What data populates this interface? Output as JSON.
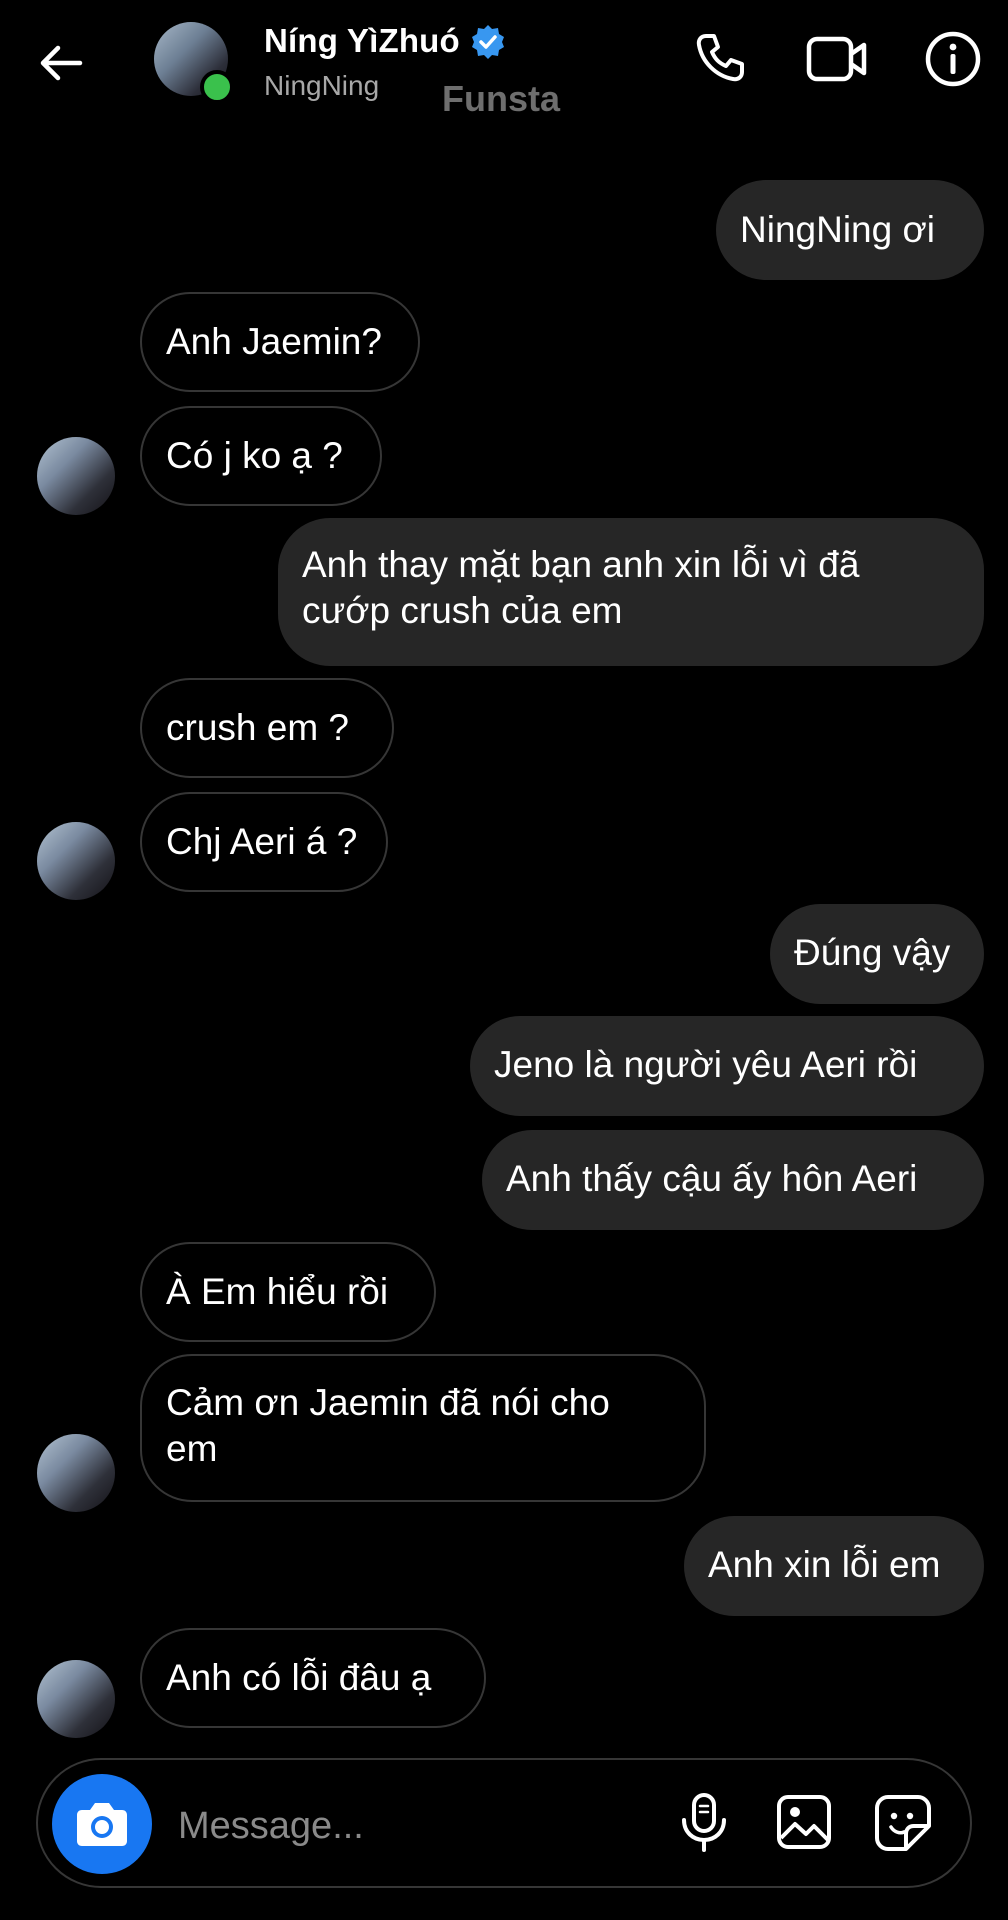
{
  "header": {
    "contact_name": "Níng YìZhuó",
    "username": "NingNing",
    "funsta_label": "Funsta",
    "icons": {
      "back": "arrow-left",
      "verified": "verified-badge",
      "call": "phone",
      "video": "video-camera",
      "info": "info-circle"
    }
  },
  "messages": [
    {
      "side": "out",
      "text": "NingNing ơi"
    },
    {
      "side": "in",
      "text": "Anh Jaemin?"
    },
    {
      "side": "in",
      "text": "Có j ko ạ ?"
    },
    {
      "side": "out",
      "text": "Anh thay mặt bạn anh xin lỗi vì đã cướp crush của em"
    },
    {
      "side": "in",
      "text": "crush em ?"
    },
    {
      "side": "in",
      "text": "Chj Aeri á ?"
    },
    {
      "side": "out",
      "text": "Đúng vậy"
    },
    {
      "side": "out",
      "text": "Jeno là người yêu Aeri rồi"
    },
    {
      "side": "out",
      "text": "Anh thấy cậu ấy hôn Aeri"
    },
    {
      "side": "in",
      "text": "À Em hiểu rồi"
    },
    {
      "side": "in",
      "text": "Cảm ơn Jaemin đã nói cho em"
    },
    {
      "side": "out",
      "text": "Anh xin lỗi em"
    },
    {
      "side": "in",
      "text": "Anh có lỗi đâu ạ"
    }
  ],
  "composer": {
    "placeholder": "Message...",
    "icons": {
      "camera": "camera",
      "mic": "microphone",
      "gallery": "image",
      "sticker": "sticker"
    }
  },
  "colors": {
    "background": "#000000",
    "outgoing_bubble": "#262626",
    "incoming_border": "#363636",
    "online_dot": "#3ac14c",
    "verified": "#3897f0",
    "camera_button": "#1877f2"
  }
}
